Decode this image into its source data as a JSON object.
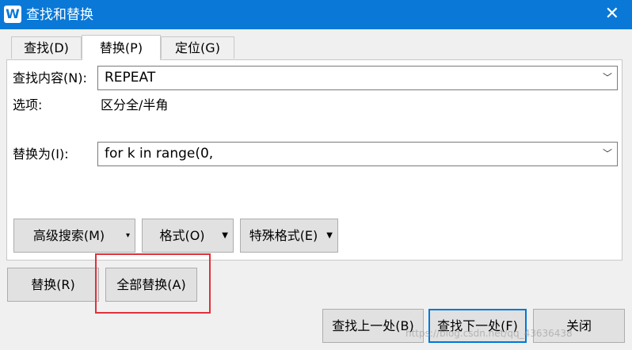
{
  "window": {
    "title": "查找和替换",
    "app_icon": "W"
  },
  "tabs": [
    {
      "label": "查找(D)"
    },
    {
      "label": "替换(P)",
      "active": true
    },
    {
      "label": "定位(G)"
    }
  ],
  "find": {
    "label": "查找内容(N):",
    "value": "REPEAT"
  },
  "options": {
    "label": "选项:",
    "value": "区分全/半角"
  },
  "replace": {
    "label": "替换为(I):",
    "value": "for k in range(0,"
  },
  "panel_buttons": {
    "advanced": "高级搜索(M)",
    "format": "格式(O)",
    "special": "特殊格式(E)"
  },
  "action_buttons": {
    "replace": "替换(R)",
    "replace_all": "全部替换(A)"
  },
  "bottom_buttons": {
    "find_prev": "查找上一处(B)",
    "find_next": "查找下一处(F)",
    "close": "关闭"
  },
  "watermark": "https://blog.csdn.net/qq_43636438"
}
